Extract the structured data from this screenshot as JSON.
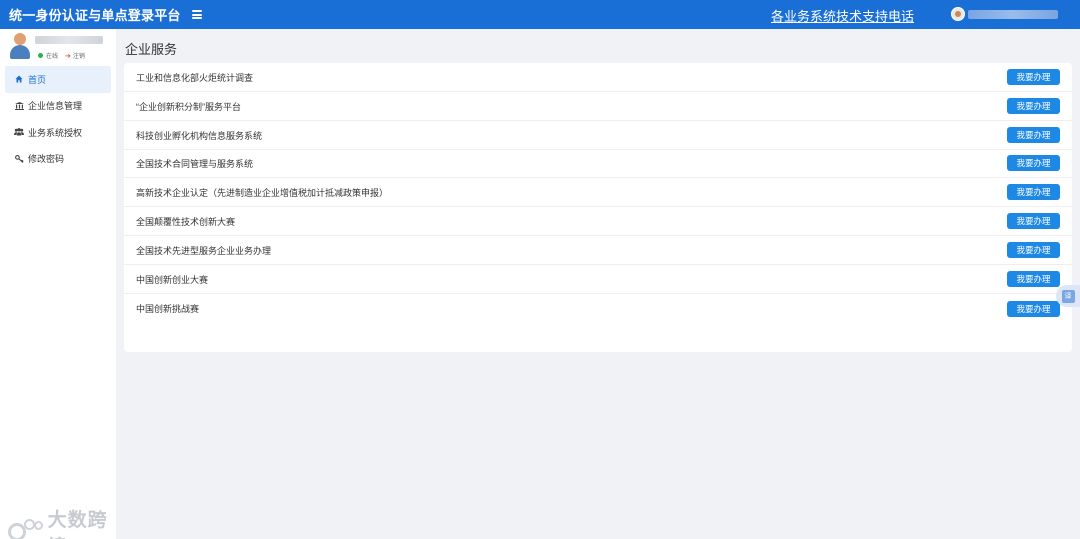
{
  "header": {
    "title": "统一身份认证与单点登录平台",
    "support_link": "各业务系统技术支持电话",
    "accent": "#1a6fd6"
  },
  "sidebar": {
    "status_online": "在线",
    "status_logout": "注销",
    "items": [
      {
        "label": "首页",
        "icon": "home-icon",
        "active": true
      },
      {
        "label": "企业信息管理",
        "icon": "bank-icon",
        "active": false
      },
      {
        "label": "业务系统授权",
        "icon": "users-icon",
        "active": false
      },
      {
        "label": "修改密码",
        "icon": "key-icon",
        "active": false
      }
    ]
  },
  "watermark": {
    "text": "大数跨境"
  },
  "main": {
    "title": "企业服务",
    "button_label": "我要办理",
    "services": [
      "工业和信息化部火炬统计调查",
      "“企业创新积分制”服务平台",
      "科技创业孵化机构信息服务系统",
      "全国技术合同管理与服务系统",
      "高新技术企业认定（先进制造业企业增值税加计抵减政策申报）",
      "全国颠覆性技术创新大赛",
      "全国技术先进型服务企业业务办理",
      "中国创新创业大赛",
      "中国创新挑战赛"
    ]
  },
  "translate_tab": {
    "label": "译"
  }
}
